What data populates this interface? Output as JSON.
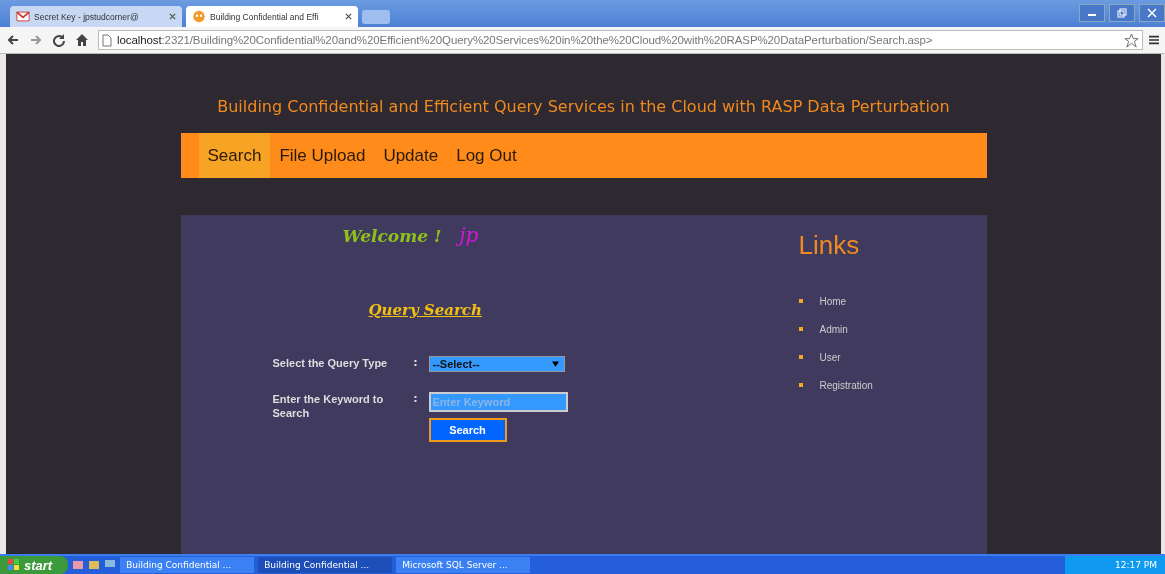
{
  "browser": {
    "tabs": [
      {
        "label": "Secret Key - jpstudcorner@",
        "selected": false,
        "kind": "mail"
      },
      {
        "label": "Building Confidential and Effi",
        "selected": true,
        "kind": "site"
      }
    ],
    "url_host": "localhost",
    "url_rest": ":2321/Building%20Confidential%20and%20Efficient%20Query%20Services%20in%20the%20Cloud%20with%20RASP%20DataPerturbation/Search.asp>"
  },
  "page": {
    "title": "Building Confidential and Efficient Query Services in the Cloud with RASP Data Perturbation",
    "nav": [
      {
        "label": "Search",
        "selected": true
      },
      {
        "label": "File Upload",
        "selected": false
      },
      {
        "label": "Update",
        "selected": false
      },
      {
        "label": "Log Out",
        "selected": false
      }
    ],
    "welcome": "Welcome !",
    "user": "jp",
    "heading": "Query Search",
    "form": {
      "query_type_label": "Select the Query Type",
      "query_type_colon": ":",
      "query_type_value": "--Select--",
      "keyword_label": "Enter the Keyword to Search",
      "keyword_colon": ":",
      "keyword_placeholder": "Enter Keyword",
      "button": "Search"
    },
    "links_title": "Links",
    "links": [
      "Home",
      "Admin",
      "User",
      "Registration"
    ]
  },
  "taskbar": {
    "start": "start",
    "tasks": [
      {
        "label": "Building Confidential ...",
        "selected": false
      },
      {
        "label": "Building Confidential ...",
        "selected": true
      },
      {
        "label": "Microsoft SQL Server ...",
        "selected": false
      }
    ],
    "clock": "12:17 PM"
  }
}
